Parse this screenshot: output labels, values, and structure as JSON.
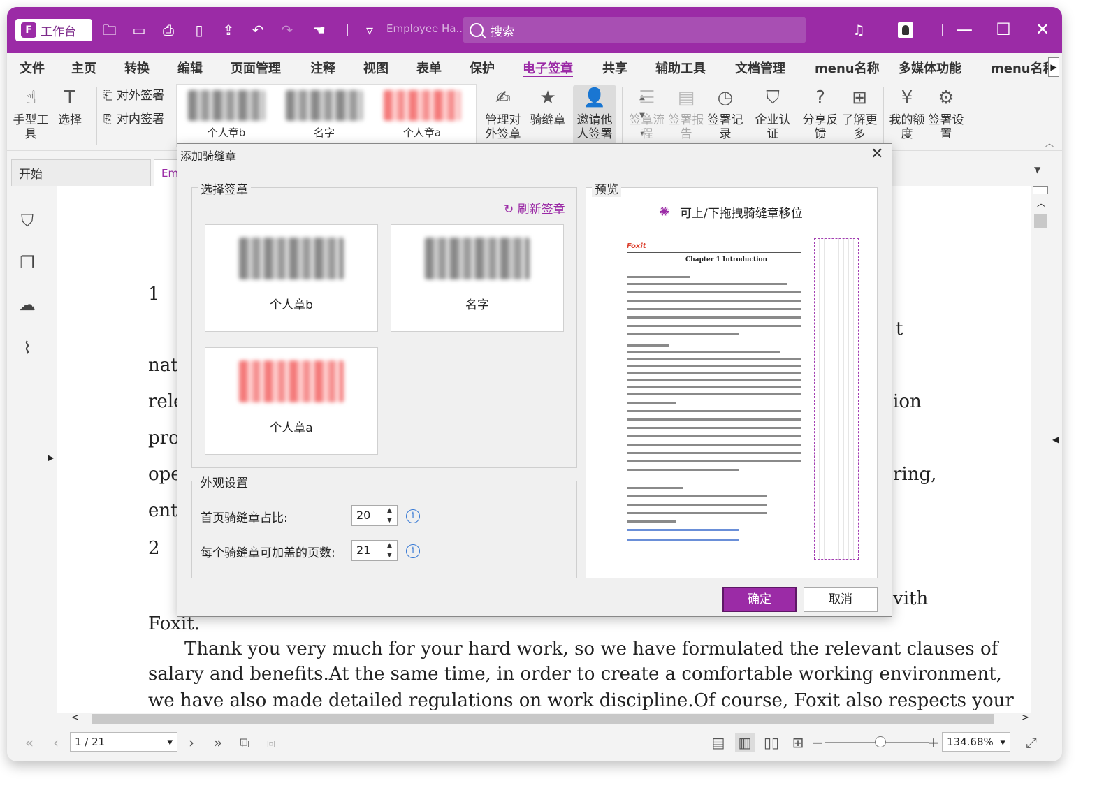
{
  "titlebar": {
    "workbench_label": "工作台",
    "doc_title": "Employee Ha...",
    "search_placeholder": "搜索"
  },
  "menu": [
    "文件",
    "主页",
    "转换",
    "编辑",
    "页面管理",
    "注释",
    "视图",
    "表单",
    "保护",
    "电子签章",
    "共享",
    "辅助工具",
    "文档管理",
    "menu名称",
    "多媒体功能",
    "menu名称"
  ],
  "menu_active": "电子签章",
  "ribbon": {
    "hand_tool": "手型工具",
    "select": "选择",
    "external_sign": "对外签署",
    "internal_sign": "对内签署",
    "gallery": [
      "个人章b",
      "名字",
      "个人章a"
    ],
    "manage_external": "管理对外签章",
    "straddle_seal": "骑缝章",
    "invite_sign": "邀请他人签署",
    "sign_flow": "签章流程",
    "sign_report": "签署报告",
    "sign_record": "签署记录",
    "enterprise_cert": "企业认证",
    "share_feedback": "分享反馈",
    "learn_more": "了解更多",
    "my_quota": "我的额度",
    "sign_settings": "签署设置"
  },
  "tabs": {
    "start": "开始",
    "doc": "Em"
  },
  "document": {
    "lines": [
      "1",
      "nat",
      "rele",
      "pro",
      "ope",
      "ent",
      "2",
      "Foxit.",
      "t",
      "ion",
      "ring,",
      "vith"
    ],
    "para1": "Thank you very much for your hard work, so we have formulated the relevant clauses of",
    "para2": "salary and benefits.At the same time, in order to create a comfortable working environment,",
    "para3": "we have also made detailed regulations on work discipline.Of course, Foxit also respects your"
  },
  "dialog": {
    "title": "添加骑缝章",
    "select_group": "选择签章",
    "refresh": "刷新签章",
    "stamps": [
      "个人章b",
      "名字",
      "个人章a"
    ],
    "appearance_group": "外观设置",
    "first_page_ratio_label": "首页骑缝章占比:",
    "first_page_ratio": "20",
    "pages_per_seal_label": "每个骑缝章可加盖的页数:",
    "pages_per_seal": "21",
    "preview_group": "预览",
    "preview_hint": "可上/下拖拽骑缝章移位",
    "preview_page_logo": "Foxit",
    "preview_page_chapter": "Chapter 1 Introduction",
    "ok": "确定",
    "cancel": "取消"
  },
  "statusbar": {
    "page": "1 / 21",
    "zoom": "134.68%"
  },
  "colors": {
    "brand": "#9b2ba6"
  }
}
